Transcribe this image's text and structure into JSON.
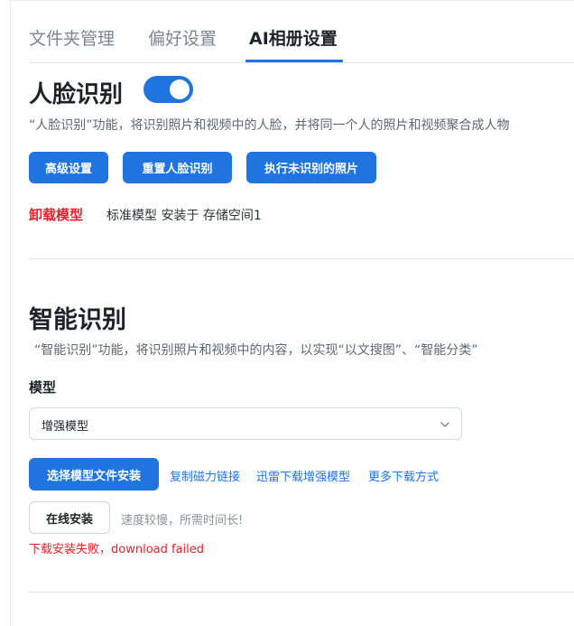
{
  "tabs": [
    {
      "label": "文件夹管理"
    },
    {
      "label": "偏好设置"
    },
    {
      "label": "AI相册设置"
    }
  ],
  "face": {
    "title": "人脸识别",
    "enabled": true,
    "description": "“人脸识别”功能，将识别照片和视频中的人脸，并将同一个人的照片和视频聚合成人物",
    "buttons": {
      "advanced": "高级设置",
      "reset": "重置人脸识别",
      "run_unrecognized": "执行未识别的照片"
    },
    "uninstall_label": "卸载模型",
    "model_info": "标准模型 安装于 存储空间1"
  },
  "smart": {
    "title": "智能识别",
    "description": "“智能识别”功能，将识别照片和视频中的内容，以实现“以文搜图”、“智能分类”",
    "model_label": "模型",
    "model_selected": "增强模型",
    "install_file_label": "选择模型文件安装",
    "links": {
      "copy_magnet": "复制磁力链接",
      "thunder": "迅雷下载增强模型",
      "more": "更多下载方式"
    },
    "online_install_label": "在线安装",
    "online_hint": "速度较慢，所需时间长!",
    "error_text": "下载安装失败，download failed"
  },
  "colors": {
    "accent": "#1f74e0",
    "danger": "#e8202c"
  }
}
